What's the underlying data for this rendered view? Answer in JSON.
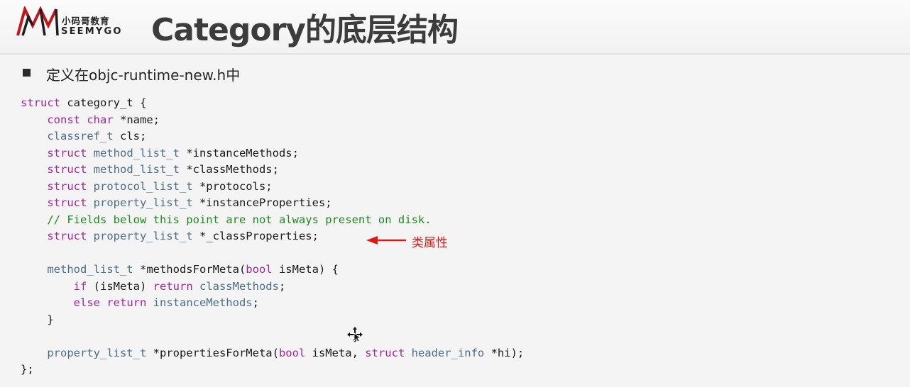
{
  "logo": {
    "text_cn": "小码哥教育",
    "text_en": "SEEMYGO",
    "mark_color": "#c4161c"
  },
  "slide": {
    "title": "Category的底层结构",
    "bullet": "定义在objc-runtime-new.h中"
  },
  "code": {
    "lines": [
      [
        {
          "t": "struct ",
          "c": "kw"
        },
        {
          "t": "category_t {",
          "c": "pl"
        }
      ],
      [
        {
          "t": "    ",
          "c": "pl"
        },
        {
          "t": "const ",
          "c": "kw"
        },
        {
          "t": "char ",
          "c": "kw"
        },
        {
          "t": "*name;",
          "c": "pl"
        }
      ],
      [
        {
          "t": "    ",
          "c": "pl"
        },
        {
          "t": "classref_t ",
          "c": "ty"
        },
        {
          "t": "cls;",
          "c": "pl"
        }
      ],
      [
        {
          "t": "    ",
          "c": "pl"
        },
        {
          "t": "struct ",
          "c": "kw"
        },
        {
          "t": "method_list_t ",
          "c": "ty"
        },
        {
          "t": "*instanceMethods;",
          "c": "pl"
        }
      ],
      [
        {
          "t": "    ",
          "c": "pl"
        },
        {
          "t": "struct ",
          "c": "kw"
        },
        {
          "t": "method_list_t ",
          "c": "ty"
        },
        {
          "t": "*classMethods;",
          "c": "pl"
        }
      ],
      [
        {
          "t": "    ",
          "c": "pl"
        },
        {
          "t": "struct ",
          "c": "kw"
        },
        {
          "t": "protocol_list_t ",
          "c": "ty"
        },
        {
          "t": "*protocols;",
          "c": "pl"
        }
      ],
      [
        {
          "t": "    ",
          "c": "pl"
        },
        {
          "t": "struct ",
          "c": "kw"
        },
        {
          "t": "property_list_t ",
          "c": "ty"
        },
        {
          "t": "*instanceProperties;",
          "c": "pl"
        }
      ],
      [
        {
          "t": "    ",
          "c": "pl"
        },
        {
          "t": "// Fields below this point are not always present on disk.",
          "c": "cm"
        }
      ],
      [
        {
          "t": "    ",
          "c": "pl"
        },
        {
          "t": "struct ",
          "c": "kw"
        },
        {
          "t": "property_list_t ",
          "c": "ty"
        },
        {
          "t": "*_classProperties;",
          "c": "pl"
        }
      ],
      [
        {
          "t": "",
          "c": "pl"
        }
      ],
      [
        {
          "t": "    ",
          "c": "pl"
        },
        {
          "t": "method_list_t ",
          "c": "ty"
        },
        {
          "t": "*methodsForMeta(",
          "c": "pl"
        },
        {
          "t": "bool ",
          "c": "kw"
        },
        {
          "t": "isMeta) {",
          "c": "pl"
        }
      ],
      [
        {
          "t": "        ",
          "c": "pl"
        },
        {
          "t": "if ",
          "c": "kw"
        },
        {
          "t": "(isMeta) ",
          "c": "pl"
        },
        {
          "t": "return ",
          "c": "kw"
        },
        {
          "t": "classMethods",
          "c": "ty"
        },
        {
          "t": ";",
          "c": "pl"
        }
      ],
      [
        {
          "t": "        ",
          "c": "pl"
        },
        {
          "t": "else ",
          "c": "kw"
        },
        {
          "t": "return ",
          "c": "kw"
        },
        {
          "t": "instanceMethods",
          "c": "ty"
        },
        {
          "t": ";",
          "c": "pl"
        }
      ],
      [
        {
          "t": "    }",
          "c": "pl"
        }
      ],
      [
        {
          "t": "",
          "c": "pl"
        }
      ],
      [
        {
          "t": "    ",
          "c": "pl"
        },
        {
          "t": "property_list_t ",
          "c": "ty"
        },
        {
          "t": "*propertiesForMeta(",
          "c": "pl"
        },
        {
          "t": "bool ",
          "c": "kw"
        },
        {
          "t": "isMeta, ",
          "c": "pl"
        },
        {
          "t": "struct ",
          "c": "kw"
        },
        {
          "t": "header_info ",
          "c": "ty"
        },
        {
          "t": "*hi);",
          "c": "pl"
        }
      ],
      [
        {
          "t": "};",
          "c": "pl"
        }
      ]
    ]
  },
  "annotation": {
    "label": "类属性",
    "color": "#e01818"
  }
}
